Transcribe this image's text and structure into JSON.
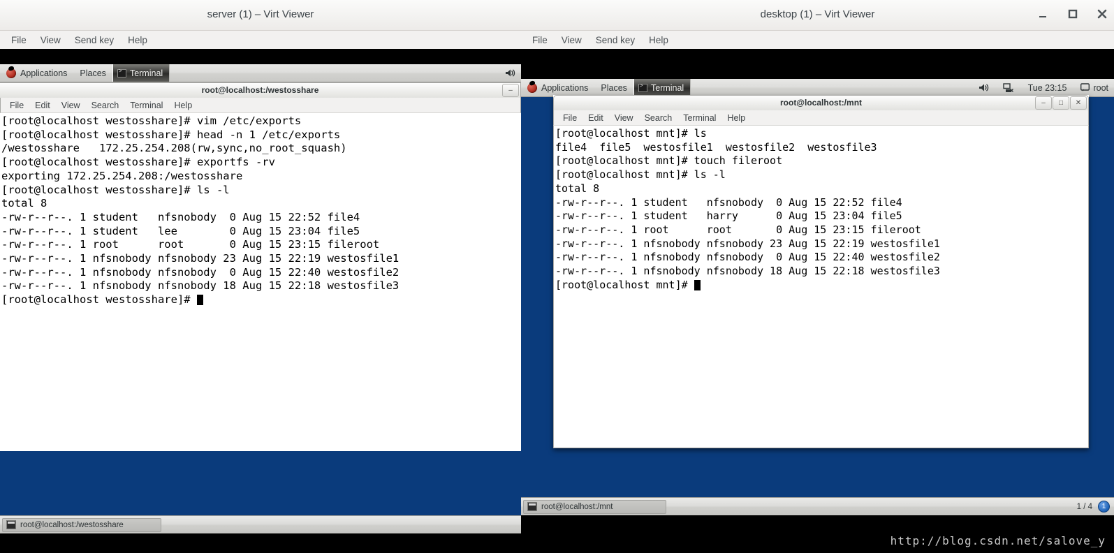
{
  "colors": {
    "desktop_blue": "#0a3b7c",
    "panel_grey": "#d6d6d3",
    "terminal_bg": "#ffffff",
    "terminal_fg": "#000000",
    "watermark_grey": "#c9c9c9"
  },
  "left_window": {
    "title": "server (1) – Virt Viewer",
    "menu": [
      "File",
      "View",
      "Send key",
      "Help"
    ],
    "gnome_panel": {
      "applications": "Applications",
      "places": "Places",
      "task": "Terminal",
      "volume_icon": "volume-icon"
    },
    "terminal": {
      "title": "root@localhost:/westosshare",
      "menu": [
        "File",
        "Edit",
        "View",
        "Search",
        "Terminal",
        "Help"
      ],
      "lines": [
        "[root@localhost westosshare]# vim /etc/exports",
        "[root@localhost westosshare]# head -n 1 /etc/exports",
        "/westosshare   172.25.254.208(rw,sync,no_root_squash)",
        "[root@localhost westosshare]# exportfs -rv",
        "exporting 172.25.254.208:/westosshare",
        "[root@localhost westosshare]# ls -l",
        "total 8",
        "-rw-r--r--. 1 student   nfsnobody  0 Aug 15 22:52 file4",
        "-rw-r--r--. 1 student   lee        0 Aug 15 23:04 file5",
        "-rw-r--r--. 1 root      root       0 Aug 15 23:15 fileroot",
        "-rw-r--r--. 1 nfsnobody nfsnobody 23 Aug 15 22:19 westosfile1",
        "-rw-r--r--. 1 nfsnobody nfsnobody  0 Aug 15 22:40 westosfile2",
        "-rw-r--r--. 1 nfsnobody nfsnobody 18 Aug 15 22:18 westosfile3"
      ],
      "prompt": "[root@localhost westosshare]# ",
      "minimize_label": "–"
    },
    "taskbar": {
      "item_label": "root@localhost:/westosshare"
    }
  },
  "right_window": {
    "title": "desktop (1) – Virt Viewer",
    "menu": [
      "File",
      "View",
      "Send key",
      "Help"
    ],
    "window_buttons": [
      "minimize",
      "maximize",
      "close"
    ],
    "gnome_panel": {
      "applications": "Applications",
      "places": "Places",
      "task": "Terminal",
      "volume_icon": "volume-icon",
      "network_icon": "network-disconnected-icon",
      "clock": "Tue 23:15",
      "message_icon": "message-icon",
      "user": "root"
    },
    "terminal": {
      "title": "root@localhost:/mnt",
      "menu": [
        "File",
        "Edit",
        "View",
        "Search",
        "Terminal",
        "Help"
      ],
      "buttons": [
        "–",
        "□",
        "✕"
      ],
      "lines": [
        "[root@localhost mnt]# ls",
        "file4  file5  westosfile1  westosfile2  westosfile3",
        "[root@localhost mnt]# touch fileroot",
        "[root@localhost mnt]# ls -l",
        "total 8",
        "-rw-r--r--. 1 student   nfsnobody  0 Aug 15 22:52 file4",
        "-rw-r--r--. 1 student   harry      0 Aug 15 23:04 file5",
        "-rw-r--r--. 1 root      root       0 Aug 15 23:15 fileroot",
        "-rw-r--r--. 1 nfsnobody nfsnobody 23 Aug 15 22:19 westosfile1",
        "-rw-r--r--. 1 nfsnobody nfsnobody  0 Aug 15 22:40 westosfile2",
        "-rw-r--r--. 1 nfsnobody nfsnobody 18 Aug 15 22:18 westosfile3"
      ],
      "prompt": "[root@localhost mnt]# "
    },
    "taskbar": {
      "item_label": "root@localhost:/mnt",
      "pager": "1 / 4",
      "workspace": "1"
    }
  },
  "watermark": "http://blog.csdn.net/salove_y"
}
